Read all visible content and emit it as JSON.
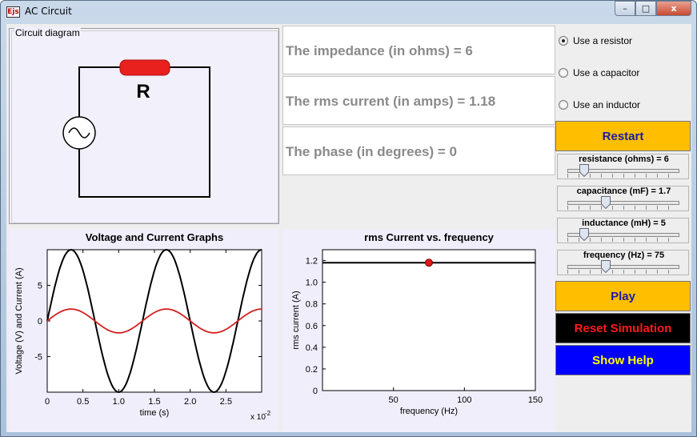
{
  "window": {
    "title": "AC Circuit",
    "icon_text": "Ejs",
    "minimize": "–",
    "maximize": "□",
    "close": "x"
  },
  "circuit": {
    "legend": "Circuit diagram",
    "component_label": "R"
  },
  "info": {
    "impedance": "The impedance (in ohms) = 6",
    "rms_current": "The rms current (in amps) = 1.18",
    "phase": "The phase (in degrees) = 0"
  },
  "options": [
    {
      "label": "Use a resistor",
      "selected": true
    },
    {
      "label": "Use a capacitor",
      "selected": false
    },
    {
      "label": "Use an inductor",
      "selected": false
    }
  ],
  "buttons": {
    "restart": "Restart",
    "play": "Play",
    "reset": "Reset Simulation",
    "help": "Show Help"
  },
  "sliders": [
    {
      "label": "resistance (ohms) = 6",
      "fraction": 0.15
    },
    {
      "label": "capacitance (mF) = 1.7",
      "fraction": 0.34
    },
    {
      "label": "inductance (mH) = 5",
      "fraction": 0.15
    },
    {
      "label": "frequency (Hz) = 75",
      "fraction": 0.34
    }
  ],
  "colors": {
    "button_yellow": "#ffbf00",
    "resistor": "#e8201e",
    "current": "#d42020",
    "voltage": "#000000"
  },
  "chart_data": [
    {
      "type": "line",
      "title": "Voltage and Current Graphs",
      "xlabel": "time (s)",
      "ylabel": "Voltage (V) and Current (A)",
      "x_multiplier": "x 10",
      "x_multiplier_exp": "-2",
      "xlim": [
        0,
        3.0
      ],
      "ylim": [
        -10,
        10
      ],
      "xticks": [
        "0",
        "0.5",
        "1.0",
        "1.5",
        "2.0",
        "2.5"
      ],
      "xtick_values": [
        0,
        0.5,
        1.0,
        1.5,
        2.0,
        2.5
      ],
      "yticks": [
        "5",
        "0",
        "-5"
      ],
      "ytick_values": [
        5,
        0,
        -5
      ],
      "series": [
        {
          "amplitude": 10,
          "frequency_hz": 75,
          "color": "#000000"
        },
        {
          "amplitude": 1.67,
          "frequency_hz": 75,
          "color": "#d42020"
        }
      ]
    },
    {
      "type": "scatter",
      "title": "rms Current vs. frequency",
      "xlabel": "frequency (Hz)",
      "ylabel": "rms current (A)",
      "xlim": [
        0,
        150
      ],
      "ylim": [
        0,
        1.3
      ],
      "xticks": [
        "50",
        "100",
        "150"
      ],
      "xtick_values": [
        50,
        100,
        150
      ],
      "yticks": [
        "0",
        "0.2",
        "0.4",
        "0.6",
        "0.8",
        "1.0",
        "1.2"
      ],
      "ytick_values": [
        0,
        0.2,
        0.4,
        0.6,
        0.8,
        1.0,
        1.2
      ],
      "line_y": 1.18,
      "point": {
        "x": 75,
        "y": 1.18
      }
    }
  ]
}
